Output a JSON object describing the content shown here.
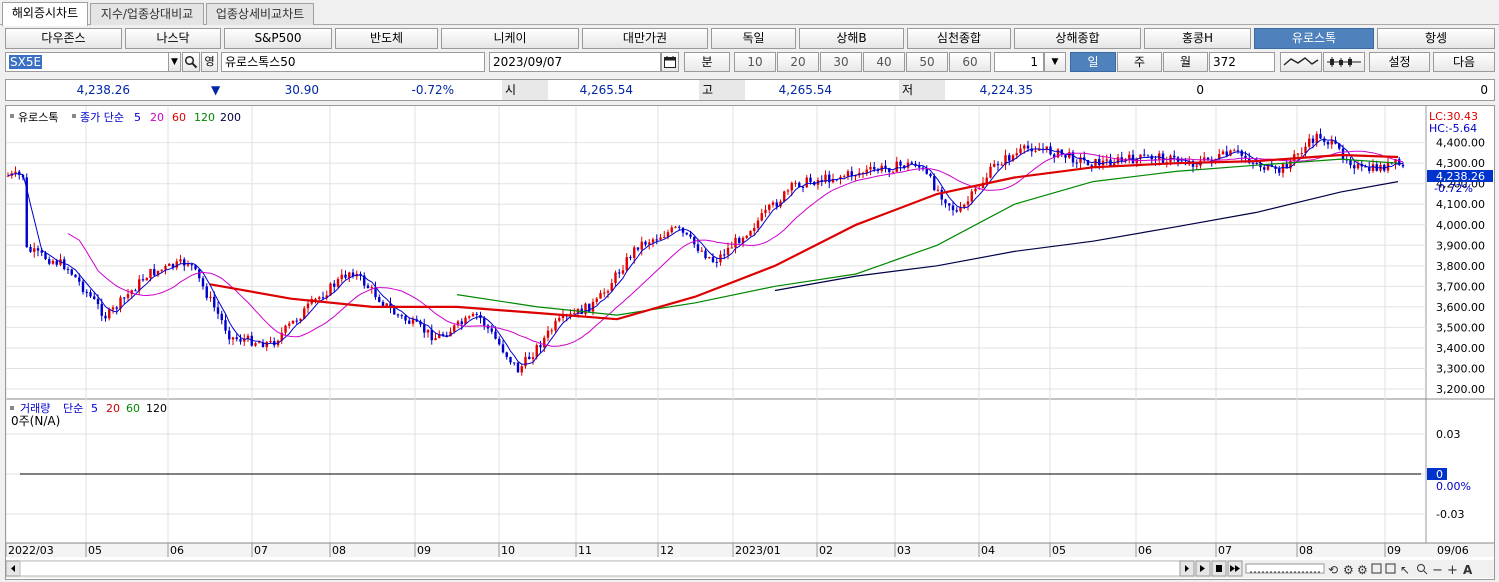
{
  "tabs": [
    {
      "label": "해외증시차트",
      "active": true
    },
    {
      "label": "지수/업종상대비교",
      "active": false
    },
    {
      "label": "업종상세비교차트",
      "active": false
    }
  ],
  "index_buttons": [
    {
      "label": "다우존스",
      "selected": false
    },
    {
      "label": "나스닥",
      "selected": false
    },
    {
      "label": "S&P500",
      "selected": false
    },
    {
      "label": "반도체",
      "selected": false
    },
    {
      "label": "니케이",
      "selected": false
    },
    {
      "label": "대만가권",
      "selected": false
    },
    {
      "label": "독일",
      "selected": false
    },
    {
      "label": "상해B",
      "selected": false
    },
    {
      "label": "심천종합",
      "selected": false
    },
    {
      "label": "상해종합",
      "selected": false
    },
    {
      "label": "홍콩H",
      "selected": false
    },
    {
      "label": "유로스톡",
      "selected": true
    },
    {
      "label": "항셍",
      "selected": false
    }
  ],
  "controls": {
    "symbol_code": "SX5E",
    "search_icon": "magnifier-icon",
    "lang_label": "영",
    "symbol_name": "유로스톡스50",
    "date": "2023/09/07",
    "calendar_icon": "calendar-icon",
    "minute_label": "분",
    "minute_options": [
      "10",
      "20",
      "30",
      "40",
      "50",
      "60"
    ],
    "minute_count": "1",
    "period_buttons": [
      {
        "label": "일",
        "selected": true
      },
      {
        "label": "주",
        "selected": false
      },
      {
        "label": "월",
        "selected": false
      }
    ],
    "bar_count": "372",
    "settings_label": "설정",
    "next_label": "다음"
  },
  "price_row": {
    "last": "4,238.26",
    "direction_symbol": "▼",
    "change": "30.90",
    "change_pct": "-0.72%",
    "open_label": "시",
    "open": "4,265.54",
    "high_label": "고",
    "high": "4,265.54",
    "low_label": "저",
    "low": "4,224.35",
    "volume": "0",
    "extra": "0"
  },
  "price_panel": {
    "legend_name": "유로스톡",
    "legend_ma_label": "종가 단순",
    "ma_periods": [
      "5",
      "20",
      "60",
      "120",
      "200"
    ],
    "ma_colors": [
      "#0000cc",
      "#cc00cc",
      "#dd0000",
      "#008800",
      "#000044"
    ],
    "right_labels": {
      "lc": "LC:30.43",
      "hc": "HC:-5.64",
      "last": "4,238.26",
      "pct": "-0.72%"
    }
  },
  "volume_panel": {
    "legend_name": "거래량",
    "legend_ma_label": "단순",
    "ma_periods": [
      "5",
      "20",
      "60",
      "120"
    ],
    "ma_colors": [
      "#0000cc",
      "#cc0000",
      "#008800",
      "#000000"
    ],
    "status_text": "0주(N/A)",
    "y_ticks": [
      "0.03",
      "0",
      "0.00%",
      "-0.03"
    ]
  },
  "x_axis": {
    "labels": [
      "2022/03",
      "05",
      "06",
      "07",
      "08",
      "09",
      "10",
      "11",
      "12",
      "2023/01",
      "02",
      "03",
      "04",
      "05",
      "06",
      "07",
      "08",
      "09"
    ],
    "cursor_date": "09/06"
  },
  "toolbar_bottom": {
    "icons": [
      "scroll-left-icon",
      "scroll-right-icon",
      "play-icon",
      "stop-icon",
      "fast-forward-icon",
      "zoom-slider-icon",
      "refresh-icon",
      "settings-icon",
      "gear-icon",
      "copy-icon",
      "window-icon",
      "cursor-icon",
      "search-icon",
      "minus-icon",
      "plus-icon",
      "text-icon"
    ]
  },
  "chart_data": {
    "type": "candlestick",
    "ylim": [
      3200,
      4450
    ],
    "y_ticks": [
      "4,400.00",
      "4,300.00",
      "4,200.00",
      "4,100.00",
      "4,000.00",
      "3,900.00",
      "3,800.00",
      "3,700.00",
      "3,600.00",
      "3,500.00",
      "3,400.00",
      "3,300.00",
      "3,200.00"
    ],
    "price_path": [
      [
        "2022/03",
        3880
      ],
      [
        "2022/04",
        3800
      ],
      [
        "2022/05",
        3550
      ],
      [
        "2022/05",
        3760
      ],
      [
        "2022/06",
        3820
      ],
      [
        "2022/06",
        3450
      ],
      [
        "2022/07",
        3420
      ],
      [
        "2022/07",
        3610
      ],
      [
        "2022/08",
        3780
      ],
      [
        "2022/08",
        3570
      ],
      [
        "2022/09",
        3450
      ],
      [
        "2022/09",
        3560
      ],
      [
        "2022/10",
        3290
      ],
      [
        "2022/10",
        3520
      ],
      [
        "2022/11",
        3620
      ],
      [
        "2022/11",
        3900
      ],
      [
        "2022/12",
        3980
      ],
      [
        "2022/12",
        3820
      ],
      [
        "2023/01",
        4000
      ],
      [
        "2023/01",
        4200
      ],
      [
        "2023/02",
        4250
      ],
      [
        "2023/03",
        4300
      ],
      [
        "2023/03",
        4050
      ],
      [
        "2023/04",
        4300
      ],
      [
        "2023/04",
        4380
      ],
      [
        "2023/05",
        4300
      ],
      [
        "2023/06",
        4330
      ],
      [
        "2023/06",
        4300
      ],
      [
        "2023/07",
        4350
      ],
      [
        "2023/07",
        4250
      ],
      [
        "2023/08",
        4440
      ],
      [
        "2023/08",
        4260
      ],
      [
        "2023/09",
        4300
      ],
      [
        "2023/09/06",
        4238.26
      ]
    ],
    "ma5": [],
    "ma20": [],
    "ma60": [
      [
        "2022/06",
        3710
      ],
      [
        "2022/07",
        3640
      ],
      [
        "2022/08",
        3600
      ],
      [
        "2022/09",
        3600
      ],
      [
        "2022/10",
        3570
      ],
      [
        "2022/11",
        3540
      ],
      [
        "2022/12",
        3650
      ],
      [
        "2023/01",
        3800
      ],
      [
        "2023/02",
        4000
      ],
      [
        "2023/03",
        4150
      ],
      [
        "2023/04",
        4230
      ],
      [
        "2023/05",
        4280
      ],
      [
        "2023/06",
        4300
      ],
      [
        "2023/07",
        4310
      ],
      [
        "2023/08",
        4340
      ],
      [
        "2023/09",
        4330
      ]
    ],
    "ma120": [
      [
        "2022/09",
        3660
      ],
      [
        "2022/10",
        3600
      ],
      [
        "2022/11",
        3560
      ],
      [
        "2022/12",
        3620
      ],
      [
        "2023/01",
        3700
      ],
      [
        "2023/02",
        3760
      ],
      [
        "2023/03",
        3900
      ],
      [
        "2023/04",
        4100
      ],
      [
        "2023/05",
        4210
      ],
      [
        "2023/06",
        4260
      ],
      [
        "2023/07",
        4290
      ],
      [
        "2023/08",
        4320
      ],
      [
        "2023/09",
        4300
      ]
    ],
    "ma200": [
      [
        "2023/01",
        3680
      ],
      [
        "2023/02",
        3750
      ],
      [
        "2023/03",
        3800
      ],
      [
        "2023/04",
        3870
      ],
      [
        "2023/05",
        3920
      ],
      [
        "2023/06",
        3990
      ],
      [
        "2023/07",
        4060
      ],
      [
        "2023/08",
        4160
      ],
      [
        "2023/09",
        4210
      ]
    ]
  }
}
